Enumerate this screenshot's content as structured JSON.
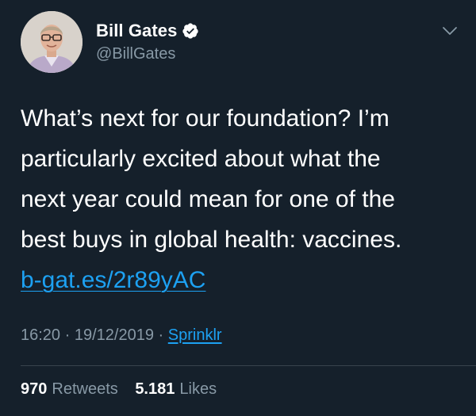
{
  "author": {
    "display_name": "Bill Gates",
    "handle": "@BillGates",
    "verified": true
  },
  "tweet": {
    "lines": [
      "What’s next for our foundation? I’m",
      "particularly excited about what the",
      "next year could mean for one of the",
      "best buys in global health: vaccines."
    ],
    "link": "b-gat.es/2r89yAC",
    "time": "16:20",
    "date": "19/12/2019",
    "separator": "·",
    "source": "Sprinklr"
  },
  "stats": {
    "retweets_count": "970",
    "retweets_label": "Retweets",
    "likes_count": "5.181",
    "likes_label": "Likes"
  },
  "colors": {
    "background": "#15202b",
    "text": "#ffffff",
    "secondary": "#8899a6",
    "accent": "#1da1f2",
    "divider": "#38444d"
  },
  "icons": {
    "verified": "verified-badge-icon",
    "caret": "chevron-down-icon"
  }
}
